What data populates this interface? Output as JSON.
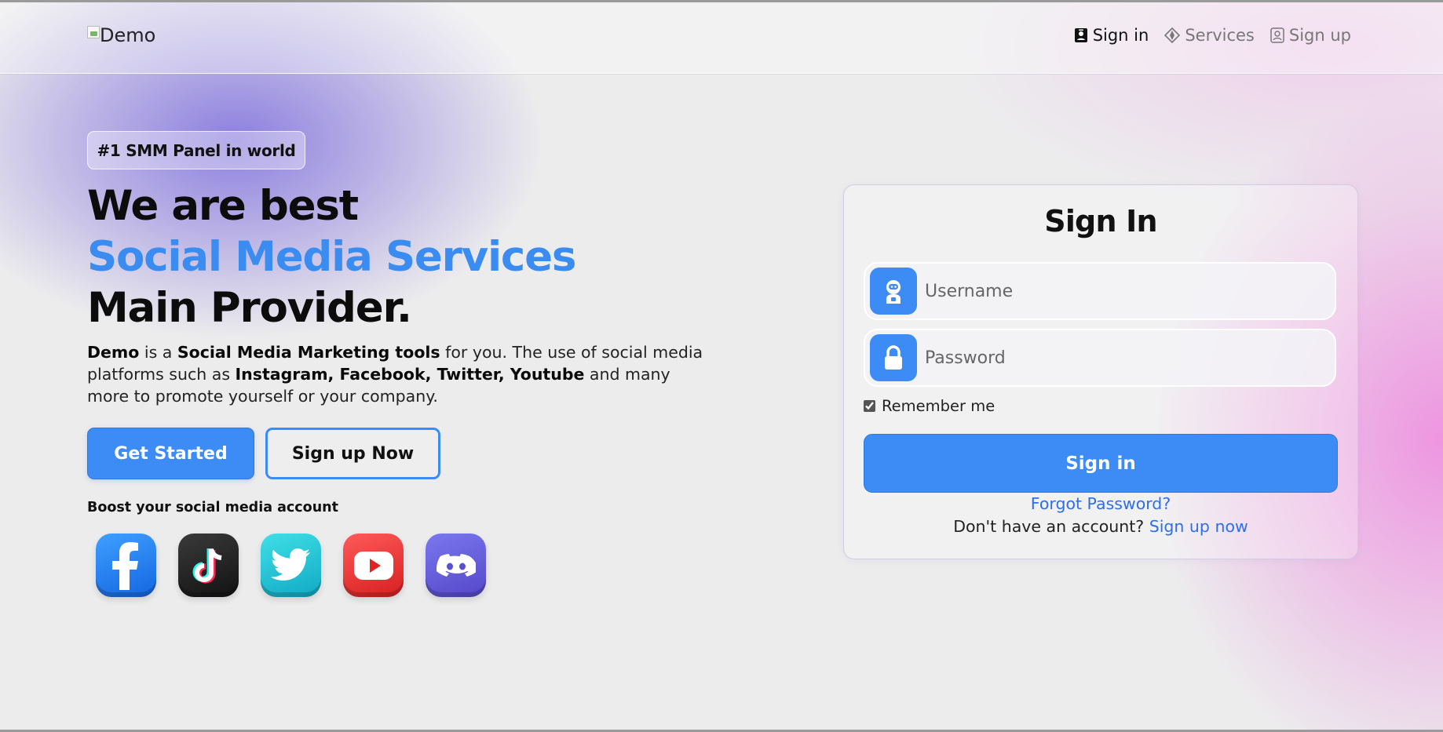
{
  "brand": {
    "alt_text": "Demo"
  },
  "nav": {
    "items": [
      {
        "label": "Sign in",
        "icon": "person-badge-icon",
        "active": true
      },
      {
        "label": "Services",
        "icon": "compass-icon",
        "active": false
      },
      {
        "label": "Sign up",
        "icon": "person-square-icon",
        "active": false
      }
    ]
  },
  "hero": {
    "badge": "#1 SMM Panel in world",
    "heading_line1": "We are best",
    "heading_line2": "Social Media Services",
    "heading_line3": "Main Provider.",
    "description": {
      "brand": "Demo",
      "t1": " is a ",
      "b1": "Social Media Marketing tools",
      "t2": " for you. The use of social media platforms such as ",
      "b2": "Instagram, Facebook, Twitter, Youtube",
      "t3": " and many more to promote yourself or your company."
    },
    "get_started_label": "Get Started",
    "signup_now_label": "Sign up Now",
    "boost_label": "Boost your social media account",
    "socials": [
      "facebook-icon",
      "tiktok-icon",
      "twitter-icon",
      "youtube-icon",
      "discord-icon"
    ]
  },
  "login": {
    "title": "Sign In",
    "username_placeholder": "Username",
    "password_placeholder": "Password",
    "remember_label": "Remember me",
    "remember_checked": true,
    "submit_label": "Sign in",
    "forgot_label": "Forgot Password?",
    "no_account_text": "Don't have an account?",
    "signup_link_label": "Sign up now"
  },
  "colors": {
    "accent": "#3d8bf5",
    "link": "#2d6fe8",
    "heading_highlight": "#3b8cf0"
  }
}
